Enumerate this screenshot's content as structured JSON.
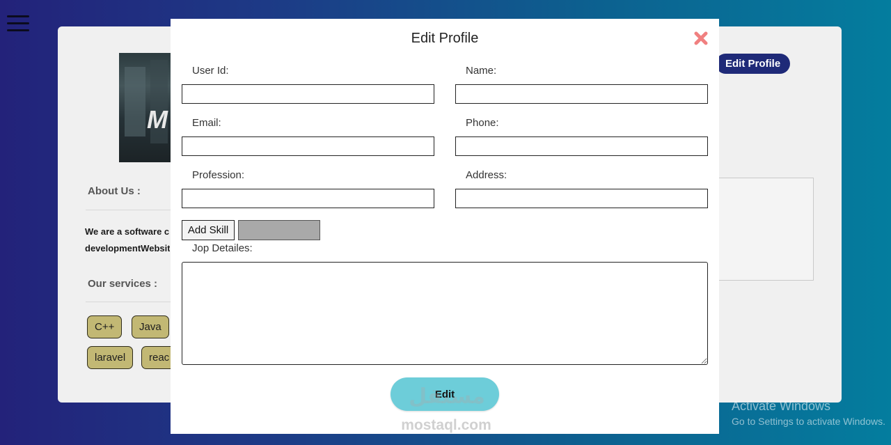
{
  "background": {
    "edit_profile_label": "Edit Profile",
    "about_heading": "About Us :",
    "about_text_line1": "We are a software c",
    "about_text_line2": "developmentWebsit",
    "services_heading": "Our services :",
    "services": [
      "C++",
      "Java",
      "laravel",
      "reac"
    ]
  },
  "modal": {
    "title": "Edit Profile",
    "fields": {
      "user_id": {
        "label": "User Id:",
        "value": ""
      },
      "name": {
        "label": "Name:",
        "value": ""
      },
      "email": {
        "label": "Email:",
        "value": ""
      },
      "phone": {
        "label": "Phone:",
        "value": ""
      },
      "profession": {
        "label": "Profession:",
        "value": ""
      },
      "address": {
        "label": "Address:",
        "value": ""
      }
    },
    "add_skill_label": "Add Skill",
    "skill_value": "",
    "job_details_label": "Jop Detailes:",
    "job_details_value": "",
    "submit_label": "Edit"
  },
  "watermark": {
    "arabic": "مستقل",
    "text": "mostaql.com"
  },
  "os_notice": {
    "title": "Activate Windows",
    "subtitle": "Go to Settings to activate Windows."
  },
  "colors": {
    "close": "#f08080",
    "submit": "#6dcdd9",
    "chip": "#c2b874",
    "edit_profile_button": "#1f2a78"
  }
}
